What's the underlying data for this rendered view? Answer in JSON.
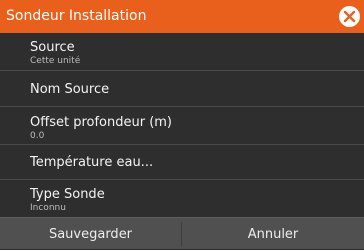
{
  "dialog": {
    "title": "Sondeur Installation",
    "colors": {
      "titlebar": "#e8601c",
      "background": "#2e2e2e",
      "footer": "#505050"
    }
  },
  "items": [
    {
      "label": "Source",
      "sub": "Cette unité"
    },
    {
      "label": "Nom Source",
      "sub": ""
    },
    {
      "label": "Offset profondeur (m)",
      "sub": "0.0"
    },
    {
      "label": "Température eau...",
      "sub": ""
    },
    {
      "label": "Type Sonde",
      "sub": "Inconnu"
    }
  ],
  "footer": {
    "save_label": "Sauvegarder",
    "cancel_label": "Annuler"
  },
  "icons": {
    "close": "close-icon"
  }
}
